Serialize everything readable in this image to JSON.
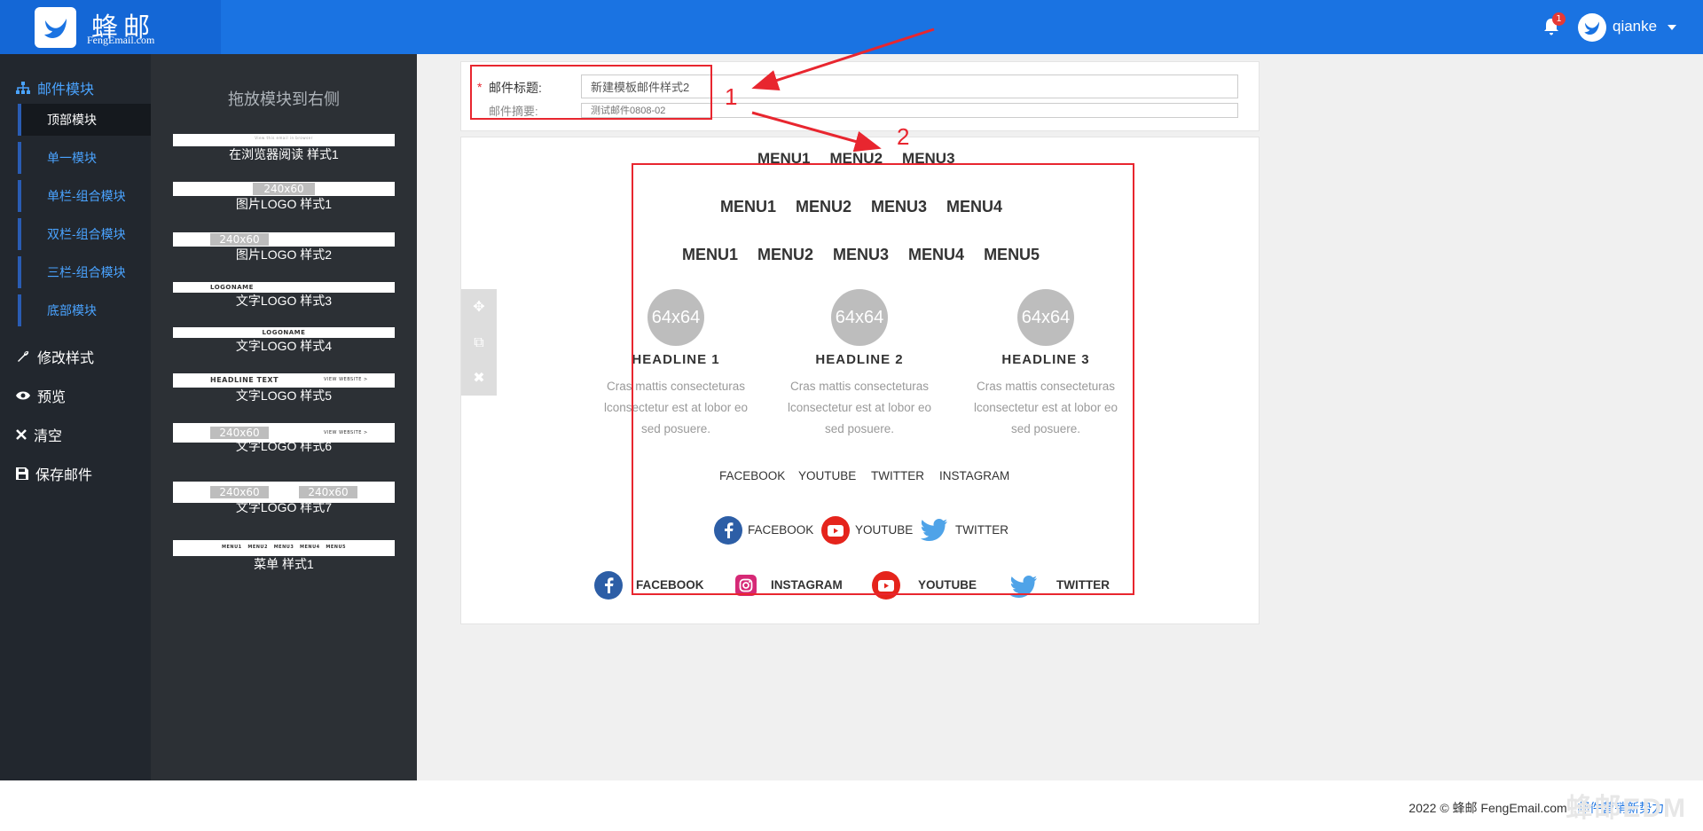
{
  "header": {
    "brand_name": "蜂邮",
    "brand_sub": "FengEmail.com",
    "notification_count": "1",
    "username": "qianke"
  },
  "sidebar": {
    "section_label": "邮件模块",
    "sub_items": [
      "顶部模块",
      "单一模块",
      "单栏-组合模块",
      "双栏-组合模块",
      "三栏-组合模块",
      "底部模块"
    ],
    "actions": [
      "修改样式",
      "预览",
      "清空",
      "保存邮件"
    ]
  },
  "module_panel": {
    "title": "拖放模块到右侧",
    "modules": [
      {
        "label": "在浏览器阅读 样式1",
        "thumb": "View this email in browser"
      },
      {
        "label": "图片LOGO 样式1",
        "thumb": "240x60"
      },
      {
        "label": "图片LOGO 样式2",
        "thumb": "240x60"
      },
      {
        "label": "文字LOGO 样式3",
        "thumb": "LOGONAME"
      },
      {
        "label": "文字LOGO 样式4",
        "thumb": "LOGONAME"
      },
      {
        "label": "文字LOGO 样式5",
        "thumb": "HEADLINE TEXT",
        "thumb_right": "VIEW WEBSITE >"
      },
      {
        "label": "文字LOGO 样式6",
        "thumb": "240x60",
        "thumb_right": "VIEW WEBSITE >"
      },
      {
        "label": "文字LOGO 样式7",
        "thumb": "240x60",
        "thumb_right": "240x60"
      },
      {
        "label": "菜单 样式1",
        "thumb": "MENU1   MENU2   MENU3   MENU4   MENU5"
      }
    ]
  },
  "subject": {
    "required_mark": "*",
    "title_label": "邮件标题:",
    "title_value": "新建模板邮件样式2",
    "summary_label": "邮件摘要:",
    "summary_placeholder": "测试邮件0808-02"
  },
  "canvas": {
    "menu_row1": [
      "MENU1",
      "MENU2",
      "MENU3"
    ],
    "menu_row2": [
      "MENU1",
      "MENU2",
      "MENU3",
      "MENU4"
    ],
    "menu_row3": [
      "MENU1",
      "MENU2",
      "MENU3",
      "MENU4",
      "MENU5"
    ],
    "columns": [
      {
        "img": "64x64",
        "headline": "HEADLINE 1",
        "body": [
          "Cras mattis consecteturas",
          "lconsectetur est at lobor eo",
          "sed posuere."
        ]
      },
      {
        "img": "64x64",
        "headline": "HEADLINE 2",
        "body": [
          "Cras mattis consecteturas",
          "lconsectetur est at lobor eo",
          "sed posuere."
        ]
      },
      {
        "img": "64x64",
        "headline": "HEADLINE 3",
        "body": [
          "Cras mattis consecteturas",
          "lconsectetur est at lobor eo",
          "sed posuere."
        ]
      }
    ],
    "social_text": [
      "FACEBOOK",
      "YOUTUBE",
      "TWITTER",
      "INSTAGRAM"
    ],
    "social_icons1": [
      "FACEBOOK",
      "YOUTUBE",
      "TWITTER"
    ],
    "social_icons2": [
      "FACEBOOK",
      "INSTAGRAM",
      "YOUTUBE",
      "TWITTER"
    ]
  },
  "annotations": {
    "label1": "1",
    "label2": "2"
  },
  "footer": {
    "copyright": "2022 © 蜂邮 FengEmail.com",
    "separator": "|",
    "slogan": "邮件营销新势力!",
    "watermark": "蜂邮EDM"
  },
  "colors": {
    "primary": "#1a73e2",
    "sidebar_bg": "#22272e",
    "panel_bg": "#2c3035",
    "annotation": "#e8262f",
    "facebook": "#2d5ea6",
    "youtube": "#e5241c",
    "instagram": "#d62976",
    "twitter": "#4fa3e8"
  }
}
